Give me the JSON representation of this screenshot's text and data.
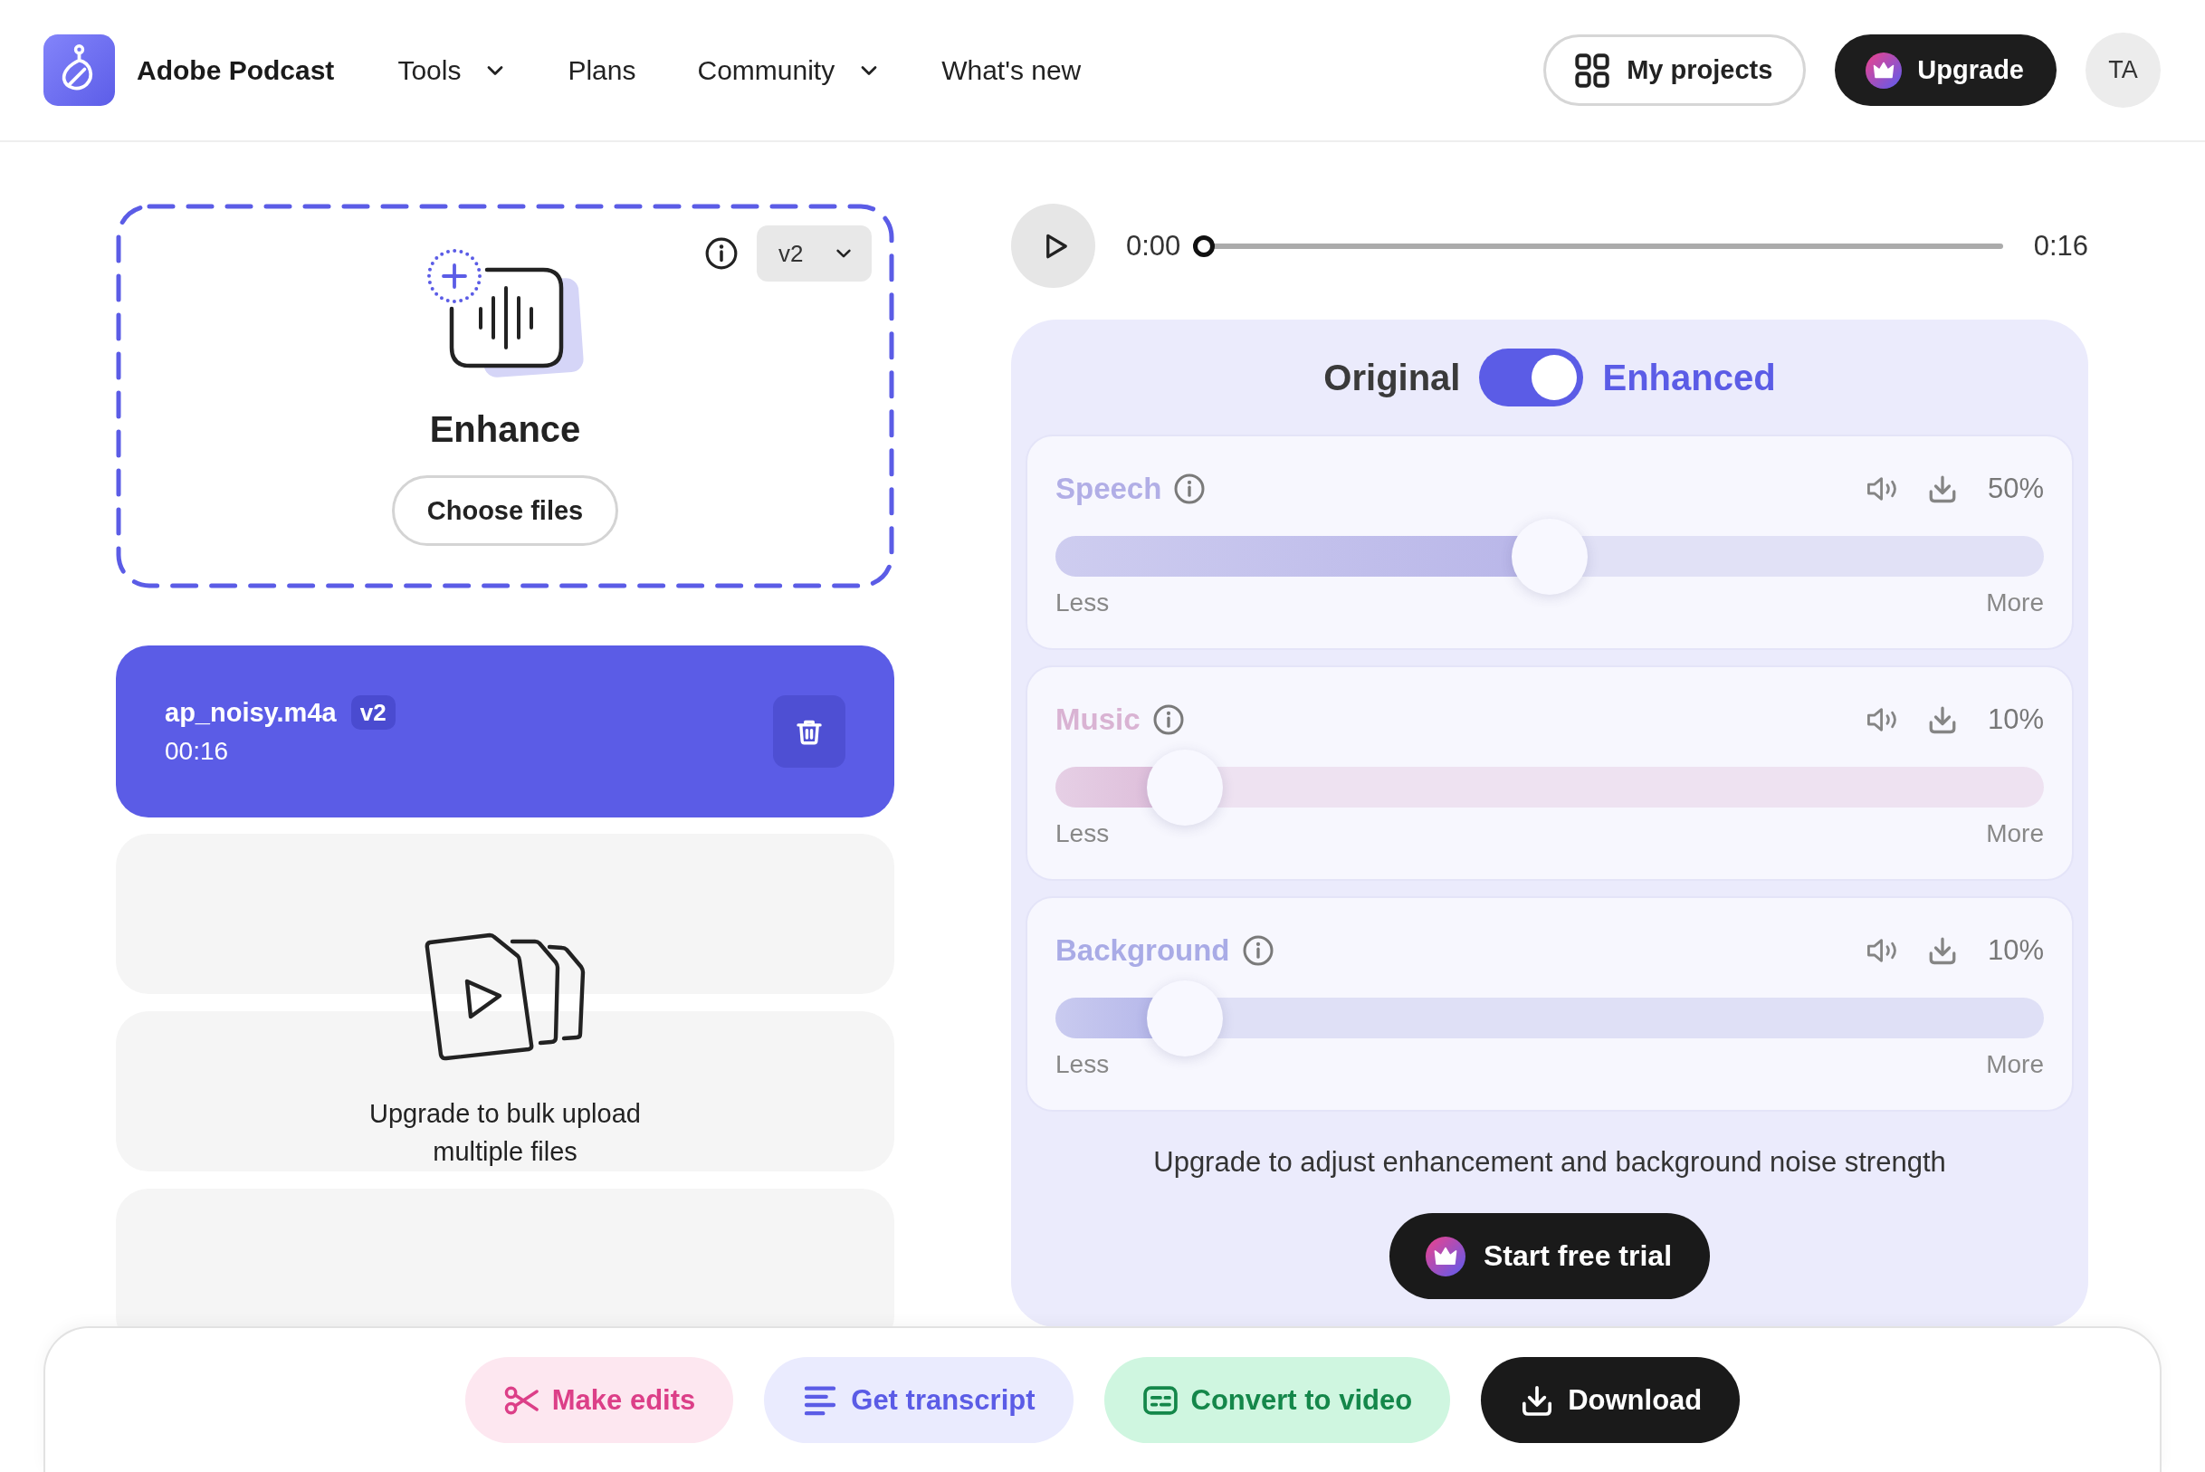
{
  "header": {
    "brand": "Adobe Podcast",
    "nav": [
      {
        "label": "Tools",
        "dropdown": true
      },
      {
        "label": "Plans",
        "dropdown": false
      },
      {
        "label": "Community",
        "dropdown": true
      },
      {
        "label": "What's new",
        "dropdown": false
      }
    ],
    "my_projects": "My projects",
    "upgrade": "Upgrade",
    "avatar": "TA"
  },
  "upload": {
    "title": "Enhance",
    "button": "Choose files",
    "version": "v2"
  },
  "files": [
    {
      "name": "ap_noisy.m4a",
      "version": "v2",
      "duration": "00:16",
      "selected": true
    }
  ],
  "bulk_upload": {
    "message": "Upgrade to bulk upload multiple files"
  },
  "player": {
    "current_time": "0:00",
    "duration": "0:16",
    "level": 0
  },
  "enhance_panel": {
    "toggle": {
      "off_label": "Original",
      "on_label": "Enhanced",
      "on": true
    },
    "channels": [
      {
        "name": "Speech",
        "color": "#b1aee6",
        "reading": "50%",
        "level": 0.5,
        "less_label": "Less",
        "more_label": "More"
      },
      {
        "name": "Music",
        "color": "#d9b3d3",
        "reading": "10%",
        "level": 0.1,
        "less_label": "Less",
        "more_label": "More"
      },
      {
        "name": "Background",
        "color": "#a9abe6",
        "reading": "10%",
        "level": 0.1,
        "less_label": "Less",
        "more_label": "More"
      }
    ],
    "upgrade_note": "Upgrade to adjust enhancement and background noise strength",
    "trial_button": "Start free trial"
  },
  "actions": [
    {
      "label": "Make edits",
      "kind": "edit"
    },
    {
      "label": "Get transcript",
      "kind": "transcript"
    },
    {
      "label": "Convert to video",
      "kind": "video"
    },
    {
      "label": "Download",
      "kind": "download"
    }
  ]
}
